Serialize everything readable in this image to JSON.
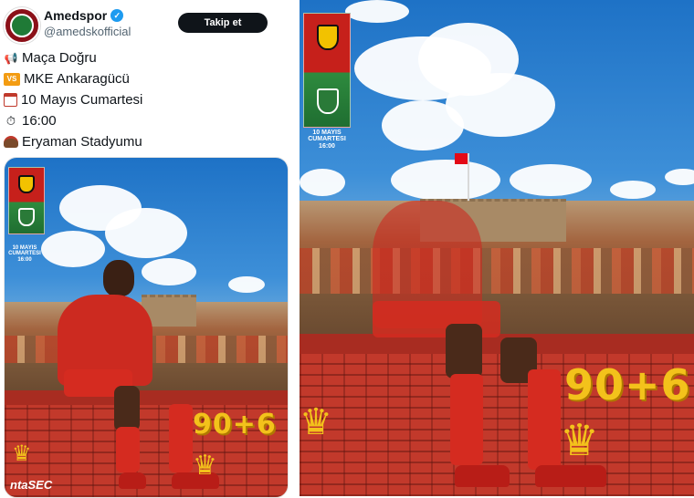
{
  "tweet": {
    "display_name": "Amedspor",
    "handle": "@amedskofficial",
    "follow_label": "Takip et",
    "lines": [
      {
        "icon": "megaphone-icon",
        "text": "Maça Doğru"
      },
      {
        "icon": "vs-icon",
        "icon_text": "VS",
        "text": "MKE Ankaragücü"
      },
      {
        "icon": "calendar-icon",
        "text": "10 Mayıs Cumartesi"
      },
      {
        "icon": "clock-icon",
        "text": "16:00"
      },
      {
        "icon": "stadium-icon",
        "text": "Eryaman Stadyumu"
      }
    ]
  },
  "poster": {
    "date_line1": "10 MAYIS",
    "date_line2": "CUMARTESI",
    "time": "16:00",
    "graffiti": "90+6",
    "watermark": "ntaSEC"
  },
  "colors": {
    "accent_red": "#c6201b",
    "accent_green": "#2e8b3e",
    "follow_button": "#0f1419",
    "verified": "#1d9bf0"
  }
}
